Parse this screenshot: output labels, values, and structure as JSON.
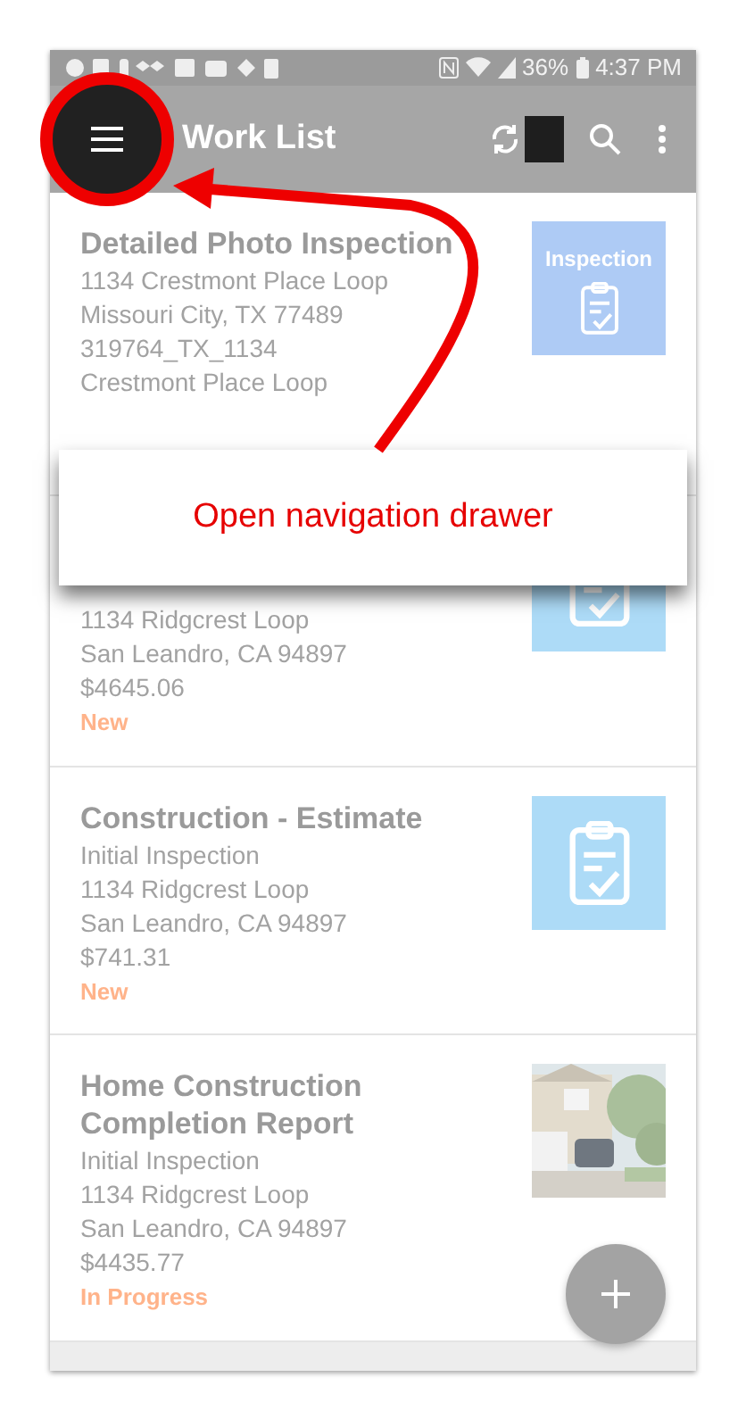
{
  "status_bar": {
    "battery": "36%",
    "time": "4:37 PM"
  },
  "app_bar": {
    "title": "Work List"
  },
  "work_items": [
    {
      "title": "Detailed Photo Inspection",
      "lines": [
        "1134 Crestmont Place Loop",
        "Missouri City, TX 77489",
        "319764_TX_1134",
        "Crestmont Place  Loop"
      ],
      "thumbnail": {
        "kind": "labeled",
        "label": "Inspection"
      }
    },
    {
      "lines": [
        "1134 Ridgcrest Loop",
        "San Leandro, CA 94897",
        "$4645.06"
      ],
      "status": "New",
      "thumbnail": {
        "kind": "clipboard"
      }
    },
    {
      "title": "Construction - Estimate",
      "lines": [
        "Initial Inspection",
        "1134 Ridgcrest Loop",
        "San Leandro, CA 94897",
        "$741.31"
      ],
      "status": "New",
      "thumbnail": {
        "kind": "clipboard"
      }
    },
    {
      "title": "Home Construction Completion Report",
      "lines": [
        "Initial Inspection",
        "1134 Ridgcrest Loop",
        "San Leandro, CA 94897",
        "$4435.77"
      ],
      "status": "In Progress"
    }
  ],
  "tooltip": {
    "text": "Open navigation drawer"
  }
}
